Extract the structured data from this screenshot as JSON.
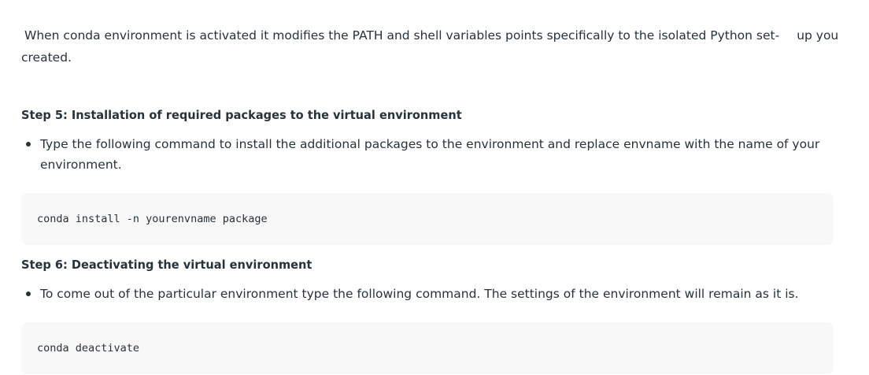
{
  "intro": {
    "line1_part1": "When conda environment is activated it modifies the PATH and shell variables points specifically to the isolated Python set-",
    "line1_part2": "up you",
    "line2": "created."
  },
  "step5": {
    "heading": "Step 5: Installation of required packages to the virtual environment",
    "bullet": "Type the following command to install the additional packages to the environment and replace envname with the name of your environment.",
    "code": "conda install -n yourenvname package"
  },
  "step6": {
    "heading": "Step 6: Deactivating the virtual environment",
    "bullet": "To come out of the particular environment type the following command. The settings of the environment will remain as it is.",
    "code": "conda deactivate"
  },
  "colors": {
    "text": "#273239",
    "code_background": "#f8f8f8"
  }
}
